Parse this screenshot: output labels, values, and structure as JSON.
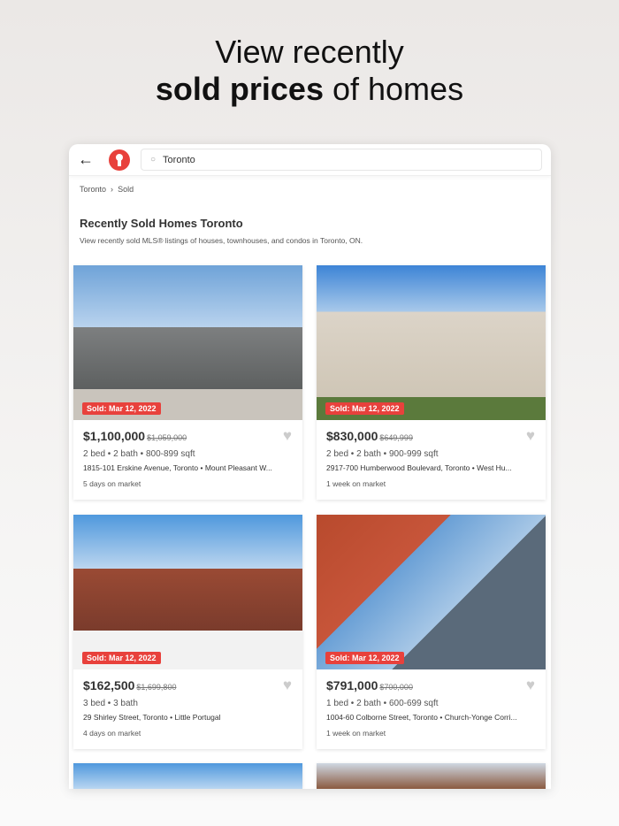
{
  "headline": {
    "line1": "View recently",
    "bold": "sold prices",
    "rest": " of homes"
  },
  "topbar": {
    "search_value": "Toronto"
  },
  "breadcrumb": [
    "Toronto",
    "Sold"
  ],
  "page": {
    "title": "Recently Sold Homes Toronto",
    "description": "View recently sold MLS® listings of houses, townhouses, and condos in Toronto, ON."
  },
  "listings": [
    {
      "badge": "Sold: Mar 12, 2022",
      "price": "$1,100,000",
      "old_price": "$1,059,000",
      "specs": "2 bed • 2 bath • 800-899 sqft",
      "address": "1815-101 Erskine Avenue, Toronto • Mount Pleasant W...",
      "market": "5 days on market"
    },
    {
      "badge": "Sold: Mar 12, 2022",
      "price": "$830,000",
      "old_price": "$649,999",
      "specs": "2 bed • 2 bath • 900-999 sqft",
      "address": "2917-700 Humberwood Boulevard, Toronto • West Hu...",
      "market": "1 week on market"
    },
    {
      "badge": "Sold: Mar 12, 2022",
      "price": "$162,500",
      "old_price": "$1,699,800",
      "specs": "3 bed • 3 bath",
      "address": "29 Shirley Street, Toronto • Little Portugal",
      "market": "4 days on market"
    },
    {
      "badge": "Sold: Mar 12, 2022",
      "price": "$791,000",
      "old_price": "$700,000",
      "specs": "1 bed • 2 bath • 600-699 sqft",
      "address": "1004-60 Colborne Street, Toronto • Church-Yonge Corri...",
      "market": "1 week on market"
    }
  ]
}
